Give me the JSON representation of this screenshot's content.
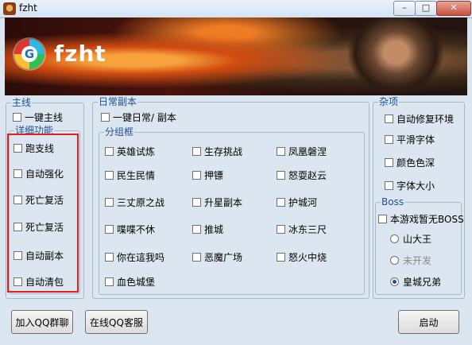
{
  "window": {
    "title": "fzht"
  },
  "banner": {
    "name": "fzht",
    "logo_letter": "G"
  },
  "main_line": {
    "legend": "主线",
    "one_click": "一键主线",
    "detail": {
      "legend": "详细功能",
      "items": [
        "跑支线",
        "自动强化",
        "死亡复活",
        "死亡复活",
        "自动副本",
        "自动清包"
      ]
    }
  },
  "daily": {
    "legend": "日常副本",
    "one_click": "一键日常/ 副本",
    "group": {
      "legend": "分组框",
      "col1": [
        "英雄试炼",
        "民生民情",
        "三丈原之战",
        "喋喋不休",
        "你在這我吗",
        "血色城堡"
      ],
      "col2": [
        "生存挑战",
        "押镖",
        "升星副本",
        "推城",
        "恶魔广场"
      ],
      "col3": [
        "凤凰磐涅",
        "怒耍赵云",
        "护城河",
        "冰东三尺",
        "怒火中烧"
      ]
    }
  },
  "misc": {
    "legend": "杂项",
    "items": [
      "自动修复环境",
      "平滑字体",
      "颜色色深",
      "字体大小"
    ],
    "boss": {
      "legend": "Boss",
      "checkbox": "本游戏暂无BOSS",
      "radios": [
        {
          "label": "山大王",
          "selected": false,
          "enabled": true
        },
        {
          "label": "未开发",
          "selected": false,
          "enabled": false
        },
        {
          "label": "皇城兄弟",
          "selected": true,
          "enabled": true
        }
      ]
    }
  },
  "buttons": {
    "join_qq": "加入QQ群聊",
    "qq_service": "在线QQ客服",
    "start": "启动"
  },
  "colors": {
    "legend": "#1f4f96",
    "highlight": "#e01f1f",
    "background": "#dce6f0"
  }
}
